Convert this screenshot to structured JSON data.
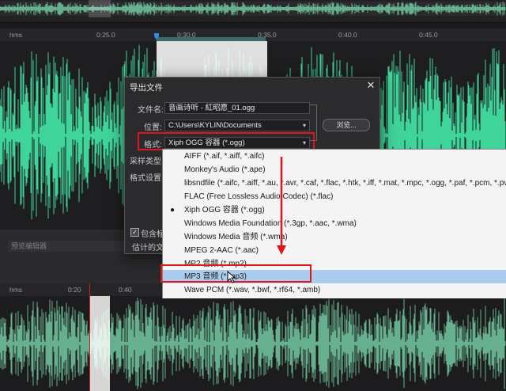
{
  "ruler_top": {
    "unit": "hms",
    "ticks": [
      "0:25.0",
      "0:30.0",
      "0:35.0",
      "0:40.0",
      "0:45.0"
    ]
  },
  "ruler_bottom": {
    "unit": "hms",
    "ticks": [
      "0:20",
      "0:40"
    ]
  },
  "preview": {
    "title": "预览编辑器"
  },
  "dialog": {
    "title": "导出文件",
    "close_glyph": "✕",
    "filename_label": "文件名:",
    "filename_value": "音画诗听 - 紅昭愿_01.ogg",
    "location_label": "位置:",
    "location_value": "C:\\Users\\KYLIN\\Documents",
    "browse_label": "浏览...",
    "format_label": "格式:",
    "format_value": "Xiph OGG 容器 (*.ogg)",
    "sample_type_label": "采样类型:",
    "format_settings_label": "格式设置:",
    "include_label": "包含标",
    "estimate_label": "估计的文",
    "checkbox_checked": true
  },
  "dropdown": {
    "options": [
      {
        "label": "AIFF (*.aif, *.aiff, *.aifc)",
        "selected": false,
        "current": false
      },
      {
        "label": "Monkey's Audio (*.ape)",
        "selected": false,
        "current": false
      },
      {
        "label": "libsndfile (*.aifc, *.aiff, *.au, *.avr, *.caf, *.flac, *.htk, *.iff, *.mat, *.mpc, *.ogg, *.paf, *.pcm, *.pvf,",
        "selected": false,
        "current": false
      },
      {
        "label": "FLAC (Free Lossless Audio Codec) (*.flac)",
        "selected": false,
        "current": false
      },
      {
        "label": "Xiph OGG 容器 (*.ogg)",
        "selected": false,
        "current": true
      },
      {
        "label": "Windows Media Foundation (*.3gp, *.aac, *.wma)",
        "selected": false,
        "current": false
      },
      {
        "label": "Windows Media 音频 (*.wma)",
        "selected": false,
        "current": false
      },
      {
        "label": "MPEG 2-AAC (*.aac)",
        "selected": false,
        "current": false
      },
      {
        "label": "MP2 音频 (*.mp2)",
        "selected": false,
        "current": false
      },
      {
        "label": "MP3 音频 (*.mp3)",
        "selected": true,
        "current": false
      },
      {
        "label": "Wave PCM (*.wav, *.bwf, *.rf64, *.amb)",
        "selected": false,
        "current": false
      }
    ],
    "current_marker": "●"
  },
  "colors": {
    "waveform": "#3fd49a",
    "waveform_dim": "#67b08f",
    "highlight_red": "#e1161d",
    "selected_row": "#aacdee"
  },
  "icons": {
    "playhead": "playhead-icon",
    "dropdown_caret": "chevron-down-icon",
    "close": "close-icon",
    "cursor": "mouse-cursor-icon",
    "arrow": "arrow-down-icon"
  }
}
